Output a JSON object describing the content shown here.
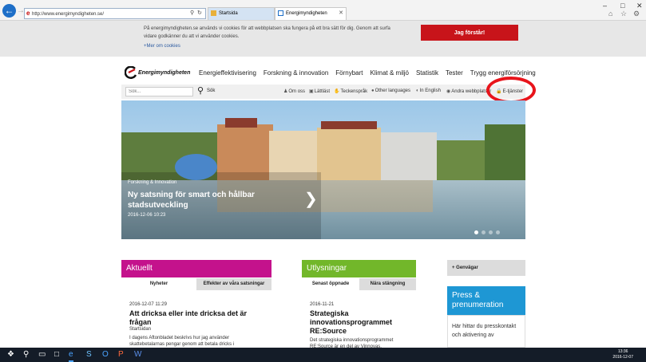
{
  "browser": {
    "url": "http://www.energimyndigheten.se/",
    "tabs": [
      {
        "label": "Startsida"
      },
      {
        "label": "Energimyndigheten"
      }
    ],
    "window_controls": [
      "–",
      "□",
      "✕"
    ]
  },
  "cookie_bar": {
    "text": "På energimyndigheten.se används vi cookies för att webbplatsen ska fungera på ett bra sätt för dig. Genom att surfa vidare godkänner du att vi använder cookies.",
    "link": "+Mer om cookies",
    "button": "Jag förstår!"
  },
  "logo_text": "Energimyndigheten",
  "main_nav": [
    "Energieffektivisering",
    "Forskning & innovation",
    "Förnybart",
    "Klimat & miljö",
    "Statistik",
    "Tester",
    "Trygg energiförsörjning"
  ],
  "search": {
    "placeholder": "Sök...",
    "label": "Sök"
  },
  "util_links": {
    "om_oss": "Om oss",
    "lattlast": "Lättläst",
    "teckensprak": "Teckenspråk",
    "other_languages": "Other languages",
    "in_english": "In English",
    "andra_webbplatser": "Andra webbplatser",
    "e_tjanster": "E-tjänster"
  },
  "hero": {
    "tag": "Forskning & Innovation",
    "title": "Ny satsning för smart och hållbar stadsutveckling",
    "date": "2016-12-06 10:23"
  },
  "aktuellt": {
    "heading": "Aktuellt",
    "tabs": [
      "Nyheter",
      "Effekter av våra satsningar"
    ],
    "date": "2016-12-07 11:29",
    "title": "Att dricksa eller inte dricksa det är frågan",
    "source": "Startsidan",
    "excerpt": "I dagens Aftonbladet beskrivs hur jag använder skattebetalarnas pengar genom att betala dricks i"
  },
  "utlysningar": {
    "heading": "Utlysningar",
    "tabs": [
      "Senast öppnade",
      "Nära stängning"
    ],
    "date": "2016-11-21",
    "title": "Strategiska innovationsprogrammet RE:Source",
    "excerpt": "Det strategiska innovationsprogrammet RE:Source är en del av Vinnovas,"
  },
  "sidebar": {
    "genvagar": "+ Genvägar",
    "press_heading": "Press & prenumeration",
    "press_text": "Här hittar du presskontakt och aktivering av"
  },
  "clock": {
    "time": "13:36",
    "date": "2016-12-07"
  },
  "colors": {
    "brand_red": "#c8141a",
    "aktuellt": "#c4128c",
    "utlysningar": "#72b72a",
    "press": "#1e97d4"
  }
}
